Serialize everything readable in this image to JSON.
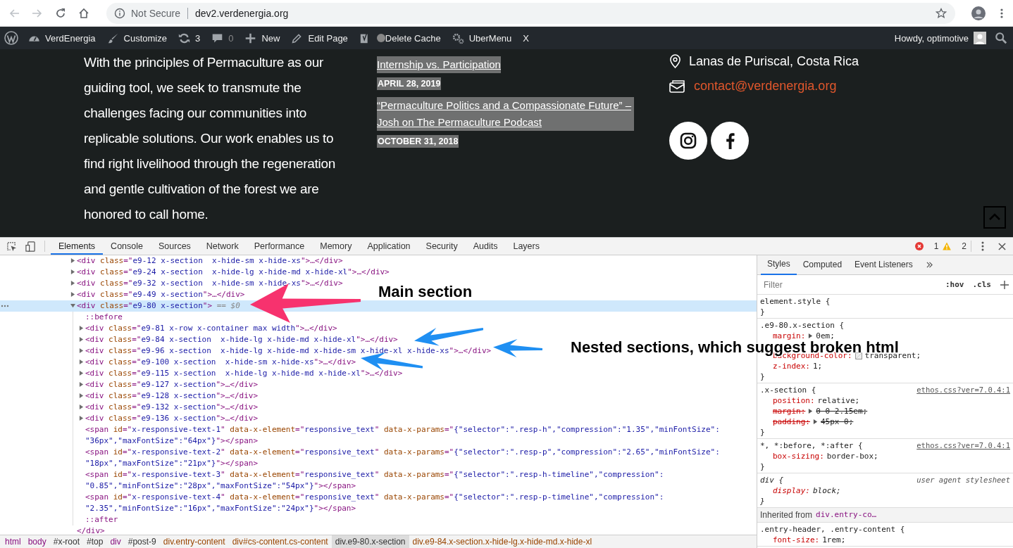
{
  "browser": {
    "nav": [
      {
        "kind": "back",
        "disabled": true
      },
      {
        "kind": "forward",
        "disabled": true
      },
      {
        "kind": "reload",
        "disabled": false
      },
      {
        "kind": "home",
        "disabled": false
      }
    ],
    "security": "Not Secure",
    "url": "dev2.verdenergia.org"
  },
  "admin_bar": {
    "items": [
      {
        "kind": "logo"
      },
      {
        "kind": "site",
        "label": "VerdEnergia"
      },
      {
        "kind": "customize",
        "label": "Customize"
      },
      {
        "kind": "updates",
        "label": "3"
      },
      {
        "kind": "comments",
        "label": "0"
      },
      {
        "kind": "new",
        "label": "New"
      },
      {
        "kind": "edit",
        "label": "Edit Page"
      },
      {
        "kind": "seo"
      },
      {
        "kind": "text",
        "label": "Delete Cache"
      },
      {
        "kind": "menu",
        "label": "UberMenu"
      },
      {
        "kind": "text",
        "label": "X"
      }
    ],
    "greeting": "Howdy, optimotive"
  },
  "footer": {
    "about": "With the principles of Permaculture as our guiding tool, we seek to transmute the challenges facing our communities into replicable solutions. Our work enables us to find right livelihood through the regeneration and gentle cultivation of the forest we are honored to call home.",
    "posts": [
      {
        "title": "Internship vs. Participation",
        "date": "APRIL 28, 2019"
      },
      {
        "title": "“Permaculture Politics and a Compassionate Future” – Josh on The Permaculture Podcast",
        "date": "OCTOBER 31, 2018"
      }
    ],
    "location": "Lanas de Puriscal, Costa Rica",
    "email": "contact@verdenergia.org",
    "social": [
      {
        "kind": "instagram"
      },
      {
        "kind": "facebook"
      }
    ]
  },
  "devtools": {
    "tabs": [
      {
        "label": "Elements",
        "selected": true
      },
      {
        "label": "Console",
        "selected": false
      },
      {
        "label": "Sources",
        "selected": false
      },
      {
        "label": "Network",
        "selected": false
      },
      {
        "label": "Performance",
        "selected": false
      },
      {
        "label": "Memory",
        "selected": false
      },
      {
        "label": "Application",
        "selected": false
      },
      {
        "label": "Security",
        "selected": false
      },
      {
        "label": "Audits",
        "selected": false
      },
      {
        "label": "Layers",
        "selected": false
      }
    ],
    "errors": "1",
    "warnings": "2",
    "tree": [
      {
        "selected": false,
        "expanded": false,
        "tokens": [
          {
            "kind": "tag",
            "text": "<div"
          },
          {
            "kind": "attr",
            "text": " class"
          },
          {
            "kind": "tag",
            "text": "=\""
          },
          {
            "kind": "val",
            "text": "e9-12 x-section  x-hide-sm x-hide-xs"
          },
          {
            "kind": "tag",
            "text": "\">…</div>"
          }
        ]
      },
      {
        "selected": false,
        "expanded": false,
        "tokens": [
          {
            "kind": "tag",
            "text": "<div"
          },
          {
            "kind": "attr",
            "text": " class"
          },
          {
            "kind": "tag",
            "text": "=\""
          },
          {
            "kind": "val",
            "text": "e9-24 x-section  x-hide-lg x-hide-md x-hide-xl"
          },
          {
            "kind": "tag",
            "text": "\">…</div>"
          }
        ]
      },
      {
        "selected": false,
        "expanded": false,
        "tokens": [
          {
            "kind": "tag",
            "text": "<div"
          },
          {
            "kind": "attr",
            "text": " class"
          },
          {
            "kind": "tag",
            "text": "=\""
          },
          {
            "kind": "val",
            "text": "e9-32 x-section  x-hide-sm x-hide-xs"
          },
          {
            "kind": "tag",
            "text": "\">…</div>"
          }
        ]
      },
      {
        "selected": false,
        "expanded": false,
        "tokens": [
          {
            "kind": "tag",
            "text": "<div"
          },
          {
            "kind": "attr",
            "text": " class"
          },
          {
            "kind": "tag",
            "text": "=\""
          },
          {
            "kind": "val",
            "text": "e9-49 x-section"
          },
          {
            "kind": "tag",
            "text": "\">…</div>"
          }
        ]
      },
      {
        "selected": true,
        "expanded": true,
        "tokens": [
          {
            "kind": "tag",
            "text": "<div"
          },
          {
            "kind": "attr",
            "text": " class"
          },
          {
            "kind": "tag",
            "text": "=\""
          },
          {
            "kind": "val",
            "text": "e9-80 x-section"
          },
          {
            "kind": "tag",
            "text": "\">"
          },
          {
            "kind": "dim",
            "text": " == $0"
          }
        ],
        "closing": [
          {
            "kind": "tag",
            "text": "</div>"
          }
        ],
        "children": [
          {
            "selected": false,
            "tokens": [
              {
                "kind": "pseudo",
                "text": "::before"
              }
            ]
          },
          {
            "selected": false,
            "expanded": false,
            "tokens": [
              {
                "kind": "tag",
                "text": "<div"
              },
              {
                "kind": "attr",
                "text": " class"
              },
              {
                "kind": "tag",
                "text": "=\""
              },
              {
                "kind": "val",
                "text": "e9-81 x-row x-container max width"
              },
              {
                "kind": "tag",
                "text": "\">…</div>"
              }
            ]
          },
          {
            "selected": false,
            "expanded": false,
            "tokens": [
              {
                "kind": "tag",
                "text": "<div"
              },
              {
                "kind": "attr",
                "text": " class"
              },
              {
                "kind": "tag",
                "text": "=\""
              },
              {
                "kind": "val",
                "text": "e9-84 x-section  x-hide-lg x-hide-md x-hide-xl"
              },
              {
                "kind": "tag",
                "text": "\">…</div>"
              }
            ]
          },
          {
            "selected": false,
            "expanded": false,
            "tokens": [
              {
                "kind": "tag",
                "text": "<div"
              },
              {
                "kind": "attr",
                "text": " class"
              },
              {
                "kind": "tag",
                "text": "=\""
              },
              {
                "kind": "val",
                "text": "e9-96 x-section  x-hide-lg x-hide-md x-hide-sm x-hide-xl x-hide-xs"
              },
              {
                "kind": "tag",
                "text": "\">…</div>"
              }
            ]
          },
          {
            "selected": false,
            "expanded": false,
            "tokens": [
              {
                "kind": "tag",
                "text": "<div"
              },
              {
                "kind": "attr",
                "text": " class"
              },
              {
                "kind": "tag",
                "text": "=\""
              },
              {
                "kind": "val",
                "text": "e9-100 x-section  x-hide-sm x-hide-xs"
              },
              {
                "kind": "tag",
                "text": "\">…</div>"
              }
            ]
          },
          {
            "selected": false,
            "expanded": false,
            "tokens": [
              {
                "kind": "tag",
                "text": "<div"
              },
              {
                "kind": "attr",
                "text": " class"
              },
              {
                "kind": "tag",
                "text": "=\""
              },
              {
                "kind": "val",
                "text": "e9-115 x-section  x-hide-lg x-hide-md x-hide-xl"
              },
              {
                "kind": "tag",
                "text": "\">…</div>"
              }
            ]
          },
          {
            "selected": false,
            "expanded": false,
            "tokens": [
              {
                "kind": "tag",
                "text": "<div"
              },
              {
                "kind": "attr",
                "text": " class"
              },
              {
                "kind": "tag",
                "text": "=\""
              },
              {
                "kind": "val",
                "text": "e9-127 x-section"
              },
              {
                "kind": "tag",
                "text": "\">…</div>"
              }
            ]
          },
          {
            "selected": false,
            "expanded": false,
            "tokens": [
              {
                "kind": "tag",
                "text": "<div"
              },
              {
                "kind": "attr",
                "text": " class"
              },
              {
                "kind": "tag",
                "text": "=\""
              },
              {
                "kind": "val",
                "text": "e9-128 x-section"
              },
              {
                "kind": "tag",
                "text": "\">…</div>"
              }
            ]
          },
          {
            "selected": false,
            "expanded": false,
            "tokens": [
              {
                "kind": "tag",
                "text": "<div"
              },
              {
                "kind": "attr",
                "text": " class"
              },
              {
                "kind": "tag",
                "text": "=\""
              },
              {
                "kind": "val",
                "text": "e9-132 x-section"
              },
              {
                "kind": "tag",
                "text": "\">…</div>"
              }
            ]
          },
          {
            "selected": false,
            "expanded": false,
            "tokens": [
              {
                "kind": "tag",
                "text": "<div"
              },
              {
                "kind": "attr",
                "text": " class"
              },
              {
                "kind": "tag",
                "text": "=\""
              },
              {
                "kind": "val",
                "text": "e9-136 x-section"
              },
              {
                "kind": "tag",
                "text": "\">…</div>"
              }
            ]
          },
          {
            "selected": false,
            "tokens": [
              {
                "kind": "tag",
                "text": "<span"
              },
              {
                "kind": "attr",
                "text": " id"
              },
              {
                "kind": "tag",
                "text": "=\""
              },
              {
                "kind": "val",
                "text": "x-responsive-text-1"
              },
              {
                "kind": "tag",
                "text": "\""
              },
              {
                "kind": "attr",
                "text": " data-x-element"
              },
              {
                "kind": "tag",
                "text": "=\""
              },
              {
                "kind": "val",
                "text": "responsive_text"
              },
              {
                "kind": "tag",
                "text": "\""
              },
              {
                "kind": "attr",
                "text": " data-x-params"
              },
              {
                "kind": "tag",
                "text": "=\""
              },
              {
                "kind": "val",
                "text": "{\"selector\":\".resp-h\",\"compression\":\"1.35\",\"minFontSize\":\"36px\",\"maxFontSize\":\"64px\"}"
              },
              {
                "kind": "tag",
                "text": "\"></span>"
              }
            ]
          },
          {
            "selected": false,
            "tokens": [
              {
                "kind": "tag",
                "text": "<span"
              },
              {
                "kind": "attr",
                "text": " id"
              },
              {
                "kind": "tag",
                "text": "=\""
              },
              {
                "kind": "val",
                "text": "x-responsive-text-2"
              },
              {
                "kind": "tag",
                "text": "\""
              },
              {
                "kind": "attr",
                "text": " data-x-element"
              },
              {
                "kind": "tag",
                "text": "=\""
              },
              {
                "kind": "val",
                "text": "responsive_text"
              },
              {
                "kind": "tag",
                "text": "\""
              },
              {
                "kind": "attr",
                "text": " data-x-params"
              },
              {
                "kind": "tag",
                "text": "=\""
              },
              {
                "kind": "val",
                "text": "{\"selector\":\".resp-p\",\"compression\":\"2.65\",\"minFontSize\":\"18px\",\"maxFontSize\":\"21px\"}"
              },
              {
                "kind": "tag",
                "text": "\"></span>"
              }
            ]
          },
          {
            "selected": false,
            "tokens": [
              {
                "kind": "tag",
                "text": "<span"
              },
              {
                "kind": "attr",
                "text": " id"
              },
              {
                "kind": "tag",
                "text": "=\""
              },
              {
                "kind": "val",
                "text": "x-responsive-text-3"
              },
              {
                "kind": "tag",
                "text": "\""
              },
              {
                "kind": "attr",
                "text": " data-x-element"
              },
              {
                "kind": "tag",
                "text": "=\""
              },
              {
                "kind": "val",
                "text": "responsive_text"
              },
              {
                "kind": "tag",
                "text": "\""
              },
              {
                "kind": "attr",
                "text": " data-x-params"
              },
              {
                "kind": "tag",
                "text": "=\""
              },
              {
                "kind": "val",
                "text": "{\"selector\":\".resp-h-timeline\",\"compression\":\"0.85\",\"minFontSize\":\"28px\",\"maxFontSize\":\"54px\"}"
              },
              {
                "kind": "tag",
                "text": "\"></span>"
              }
            ]
          },
          {
            "selected": false,
            "tokens": [
              {
                "kind": "tag",
                "text": "<span"
              },
              {
                "kind": "attr",
                "text": " id"
              },
              {
                "kind": "tag",
                "text": "=\""
              },
              {
                "kind": "val",
                "text": "x-responsive-text-4"
              },
              {
                "kind": "tag",
                "text": "\""
              },
              {
                "kind": "attr",
                "text": " data-x-element"
              },
              {
                "kind": "tag",
                "text": "=\""
              },
              {
                "kind": "val",
                "text": "responsive_text"
              },
              {
                "kind": "tag",
                "text": "\""
              },
              {
                "kind": "attr",
                "text": " data-x-params"
              },
              {
                "kind": "tag",
                "text": "=\""
              },
              {
                "kind": "val",
                "text": "{\"selector\":\".resp-p-timeline\",\"compression\":\"2.35\",\"minFontSize\":\"16px\",\"maxFontSize\":\"24px\"}"
              },
              {
                "kind": "tag",
                "text": "\"></span>"
              }
            ]
          },
          {
            "selected": false,
            "tokens": [
              {
                "kind": "pseudo",
                "text": "::after"
              }
            ]
          }
        ]
      }
    ],
    "breadcrumb": [
      {
        "text": "html",
        "kind": "tag",
        "selected": false
      },
      {
        "text": "body",
        "kind": "tag",
        "selected": false
      },
      {
        "text": "#x-root",
        "kind": "id",
        "selected": false
      },
      {
        "text": "#top",
        "kind": "id",
        "selected": false
      },
      {
        "text": "div",
        "kind": "tag",
        "selected": false
      },
      {
        "text": "#post-9",
        "kind": "id",
        "selected": false
      },
      {
        "text": "div.entry-content",
        "kind": "class",
        "selected": false
      },
      {
        "text": "div#cs-content.cs-content",
        "kind": "class",
        "selected": false
      },
      {
        "text": "div.e9-80.x-section",
        "kind": "class",
        "selected": true
      },
      {
        "text": "div.e9-84.x-section.x-hide-lg.x-hide-md.x-hide-xl",
        "kind": "class",
        "selected": false
      }
    ],
    "styles": {
      "tabs": [
        {
          "label": "Styles",
          "selected": true
        },
        {
          "label": "Computed",
          "selected": false
        },
        {
          "label": "Event Listeners",
          "selected": false
        }
      ],
      "filter": {
        "placeholder": "Filter"
      },
      "hov": ":hov",
      "cls": ".cls",
      "rules": [
        {
          "kind": "inline",
          "selector": "element.style {",
          "close": "}"
        },
        {
          "kind": "author",
          "selector": ".e9-80.x-section {",
          "close": "}",
          "props": [
            {
              "name": "margin:",
              "value": "0em;",
              "struck": false,
              "expander": true,
              "swatch": false
            },
            {
              "name": "background-color:",
              "value": "transparent;",
              "struck": false,
              "expander": false,
              "swatch": true
            },
            {
              "name": "z-index:",
              "value": "1;",
              "struck": false,
              "expander": false,
              "swatch": false
            }
          ]
        },
        {
          "kind": "author",
          "selector": ".x-section {",
          "source": "ethos.css?ver=7.0.4:1",
          "close": "}",
          "props": [
            {
              "name": "position:",
              "value": "relative;",
              "struck": false,
              "expander": false,
              "swatch": false
            },
            {
              "name": "margin:",
              "value": "0 0 2.15em;",
              "struck": true,
              "expander": true,
              "swatch": false
            },
            {
              "name": "padding:",
              "value": "45px 0;",
              "struck": true,
              "expander": true,
              "swatch": false
            }
          ]
        },
        {
          "kind": "author",
          "selector": "*, *:before, *:after {",
          "source": "ethos.css?ver=7.0.4:1",
          "close": "}",
          "props": [
            {
              "name": "box-sizing:",
              "value": "border-box;",
              "struck": false,
              "expander": false,
              "swatch": false
            }
          ]
        },
        {
          "kind": "user-agent",
          "selector": "div {",
          "source": "user agent stylesheet",
          "close": "}",
          "props": [
            {
              "name": "display:",
              "value": "block;",
              "struck": false,
              "expander": false,
              "swatch": false
            }
          ]
        },
        {
          "kind": "inherited",
          "label": "Inherited from",
          "link": "div.entry-co…"
        },
        {
          "kind": "author",
          "selector": ".entry-header, .entry-content {",
          "props": [
            {
              "name": "font-size:",
              "value": "1rem;",
              "struck": false,
              "expander": false,
              "swatch": false
            }
          ]
        }
      ]
    }
  },
  "annotations": [
    {
      "text": "Main section",
      "color": "#f7326e"
    },
    {
      "text": "Nested sections, which suggest broken html",
      "color": "#1f8ff2"
    }
  ]
}
